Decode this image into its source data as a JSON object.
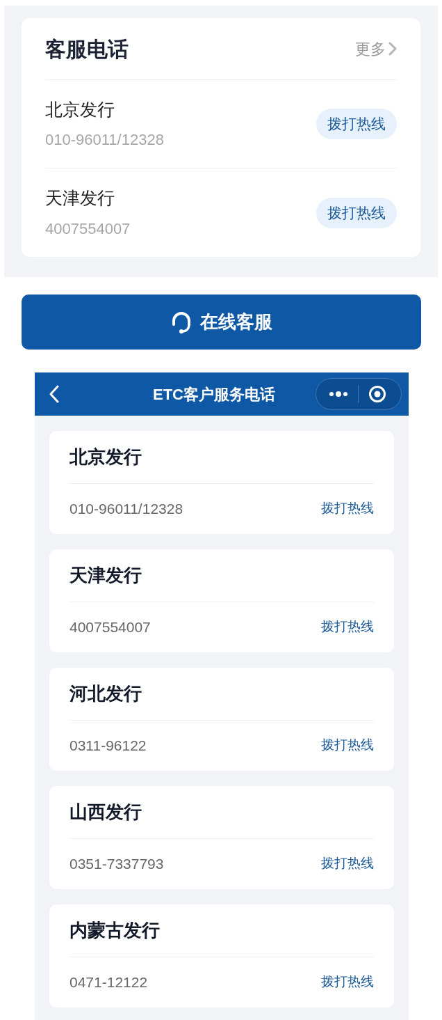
{
  "service_card": {
    "title": "客服电话",
    "more_link": "更多",
    "items": [
      {
        "name": "北京发行",
        "phone": "010-96011/12328",
        "button": "拨打热线"
      },
      {
        "name": "天津发行",
        "phone": "4007554007",
        "button": "拨打热线"
      }
    ]
  },
  "online_button": "在线客服",
  "mini_program": {
    "nav_title": "ETC客户服务电话",
    "items": [
      {
        "name": "北京发行",
        "phone": "010-96011/12328",
        "link": "拨打热线"
      },
      {
        "name": "天津发行",
        "phone": "4007554007",
        "link": "拨打热线"
      },
      {
        "name": "河北发行",
        "phone": "0311-96122",
        "link": "拨打热线"
      },
      {
        "name": "山西发行",
        "phone": "0351-7337793",
        "link": "拨打热线"
      },
      {
        "name": "内蒙古发行",
        "phone": "0471-12122",
        "link": "拨打热线"
      }
    ]
  }
}
